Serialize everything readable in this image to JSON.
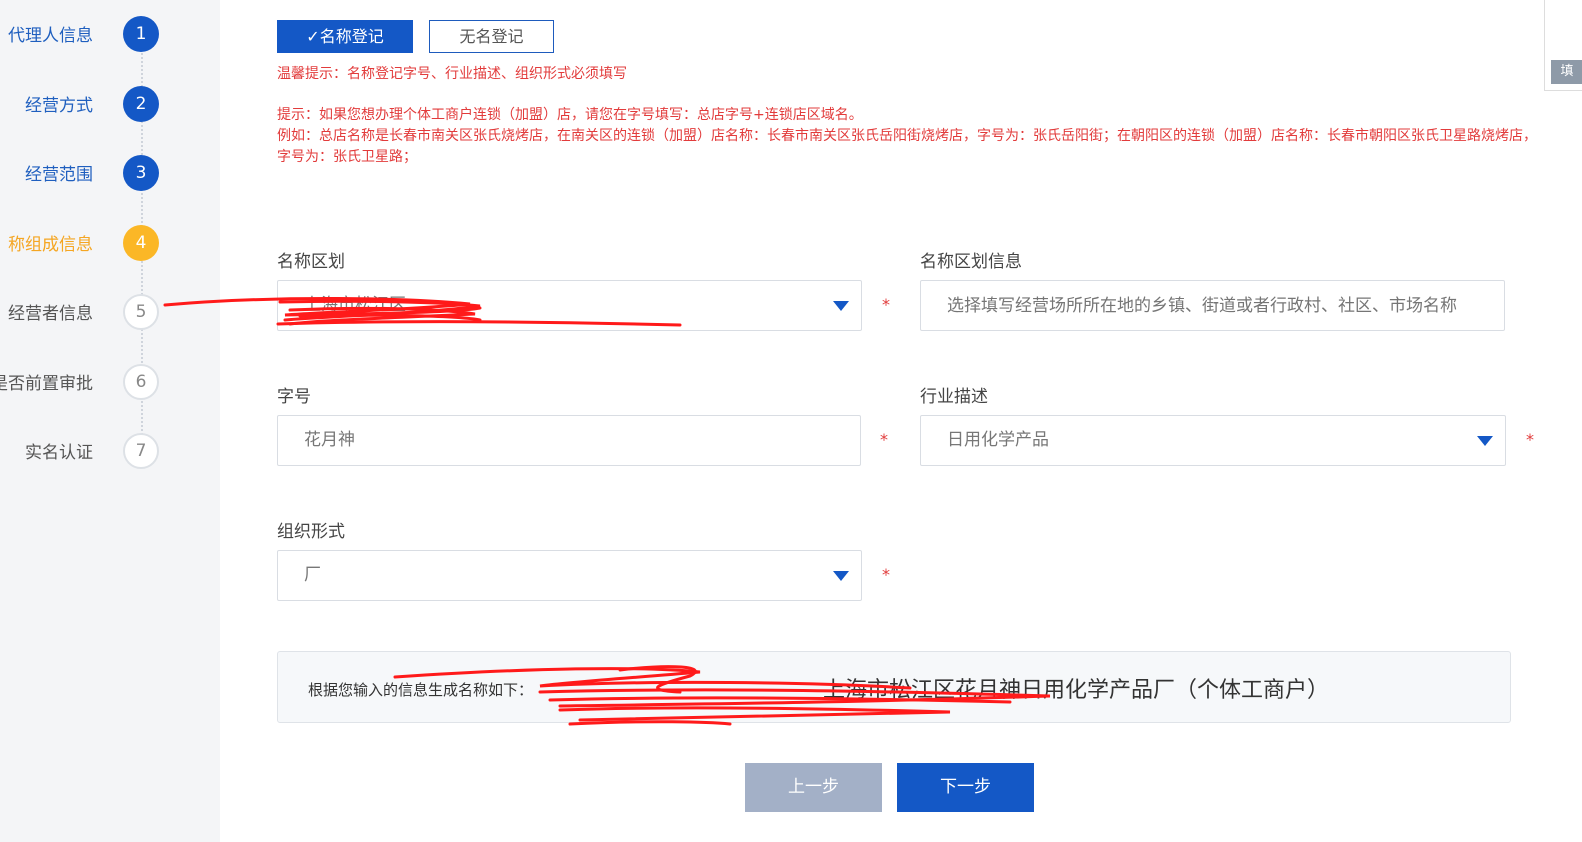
{
  "steps": [
    {
      "label": "代理人信息",
      "num": "1",
      "state": "done"
    },
    {
      "label": "经营方式",
      "num": "2",
      "state": "done"
    },
    {
      "label": "经营范围",
      "num": "3",
      "state": "done"
    },
    {
      "label": "称组成信息",
      "num": "4",
      "state": "current"
    },
    {
      "label": "经营者信息",
      "num": "5",
      "state": "todo"
    },
    {
      "label": "是否前置审批",
      "num": "6",
      "state": "todo"
    },
    {
      "label": "实名认证",
      "num": "7",
      "state": "todo"
    }
  ],
  "mode": {
    "named": "✓名称登记",
    "unnamed": "无名登记"
  },
  "tips": {
    "warm": "温馨提示：名称登记字号、行业描述、组织形式必须填写",
    "chain": "提示：如果您想办理个体工商户连锁（加盟）店，请您在字号填写：总店字号+连锁店区域名。",
    "example": "例如：总店名称是长春市南关区张氏烧烤店，在南关区的连锁（加盟）店名称：长春市南关区张氏岳阳街烧烤店，字号为：张氏岳阳街；在朝阳区的连锁（加盟）店名称：长春市朝阳区张氏卫星路烧烤店，字号为：张氏卫星路；"
  },
  "form": {
    "region": {
      "label": "名称区划",
      "value": "上海市松江区"
    },
    "region_info": {
      "label": "名称区划信息",
      "placeholder": "选择填写经营场所所在地的乡镇、街道或者行政村、社区、市场名称"
    },
    "trade_name": {
      "label": "字号",
      "value": "花月神"
    },
    "industry": {
      "label": "行业描述",
      "value": "日用化学产品"
    },
    "org_form": {
      "label": "组织形式",
      "value": "厂"
    },
    "required_mark": "*"
  },
  "result": {
    "label": "根据您输入的信息生成名称如下：",
    "value": "上海市松江区花月神日用化学产品厂（个体工商户）"
  },
  "buttons": {
    "prev": "上一步",
    "next": "下一步"
  },
  "corner": {
    "tab": "填"
  },
  "colors": {
    "primary": "#1458c6",
    "current": "#fbb726",
    "warning": "#e23b3b",
    "disabled": "#a3b0c7"
  }
}
